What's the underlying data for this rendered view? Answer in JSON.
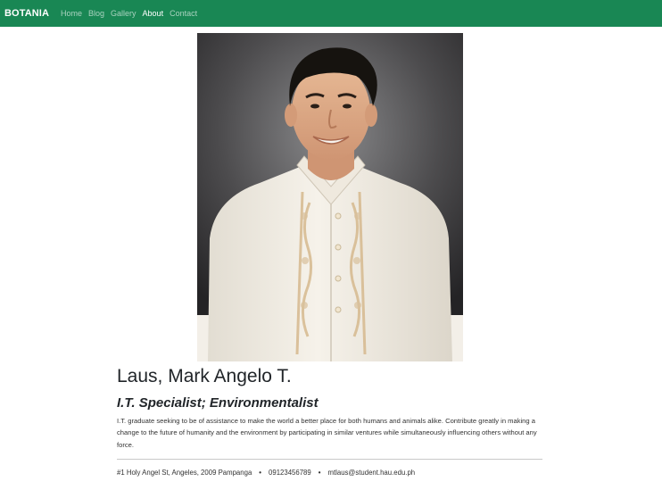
{
  "navbar": {
    "brand": "BOTANIA",
    "links": [
      {
        "label": "Home",
        "active": false
      },
      {
        "label": "Blog",
        "active": false
      },
      {
        "label": "Gallery",
        "active": false
      },
      {
        "label": "About",
        "active": true
      },
      {
        "label": "Contact",
        "active": false
      }
    ]
  },
  "profile": {
    "name": "Laus, Mark Angelo T.",
    "title": "I.T. Specialist; Environmentalist",
    "bio": "I.T. graduate seeking to be of assistance to make the world a better place for both humans and animals alike. Contribute greatly in making a change to the future of humanity and the environment by participating in similar ventures while simultaneously influencing others without any force.",
    "contact": {
      "address": "#1 Holy Angel St, Angeles, 2009 Pampanga",
      "phone": "09123456789",
      "email": "mtlaus@student.hau.edu.ph",
      "separator": "•"
    }
  },
  "colors": {
    "navbar_bg": "#198754",
    "nav_active": "#ffffff",
    "nav_inactive": "rgba(255,255,255,0.62)"
  }
}
